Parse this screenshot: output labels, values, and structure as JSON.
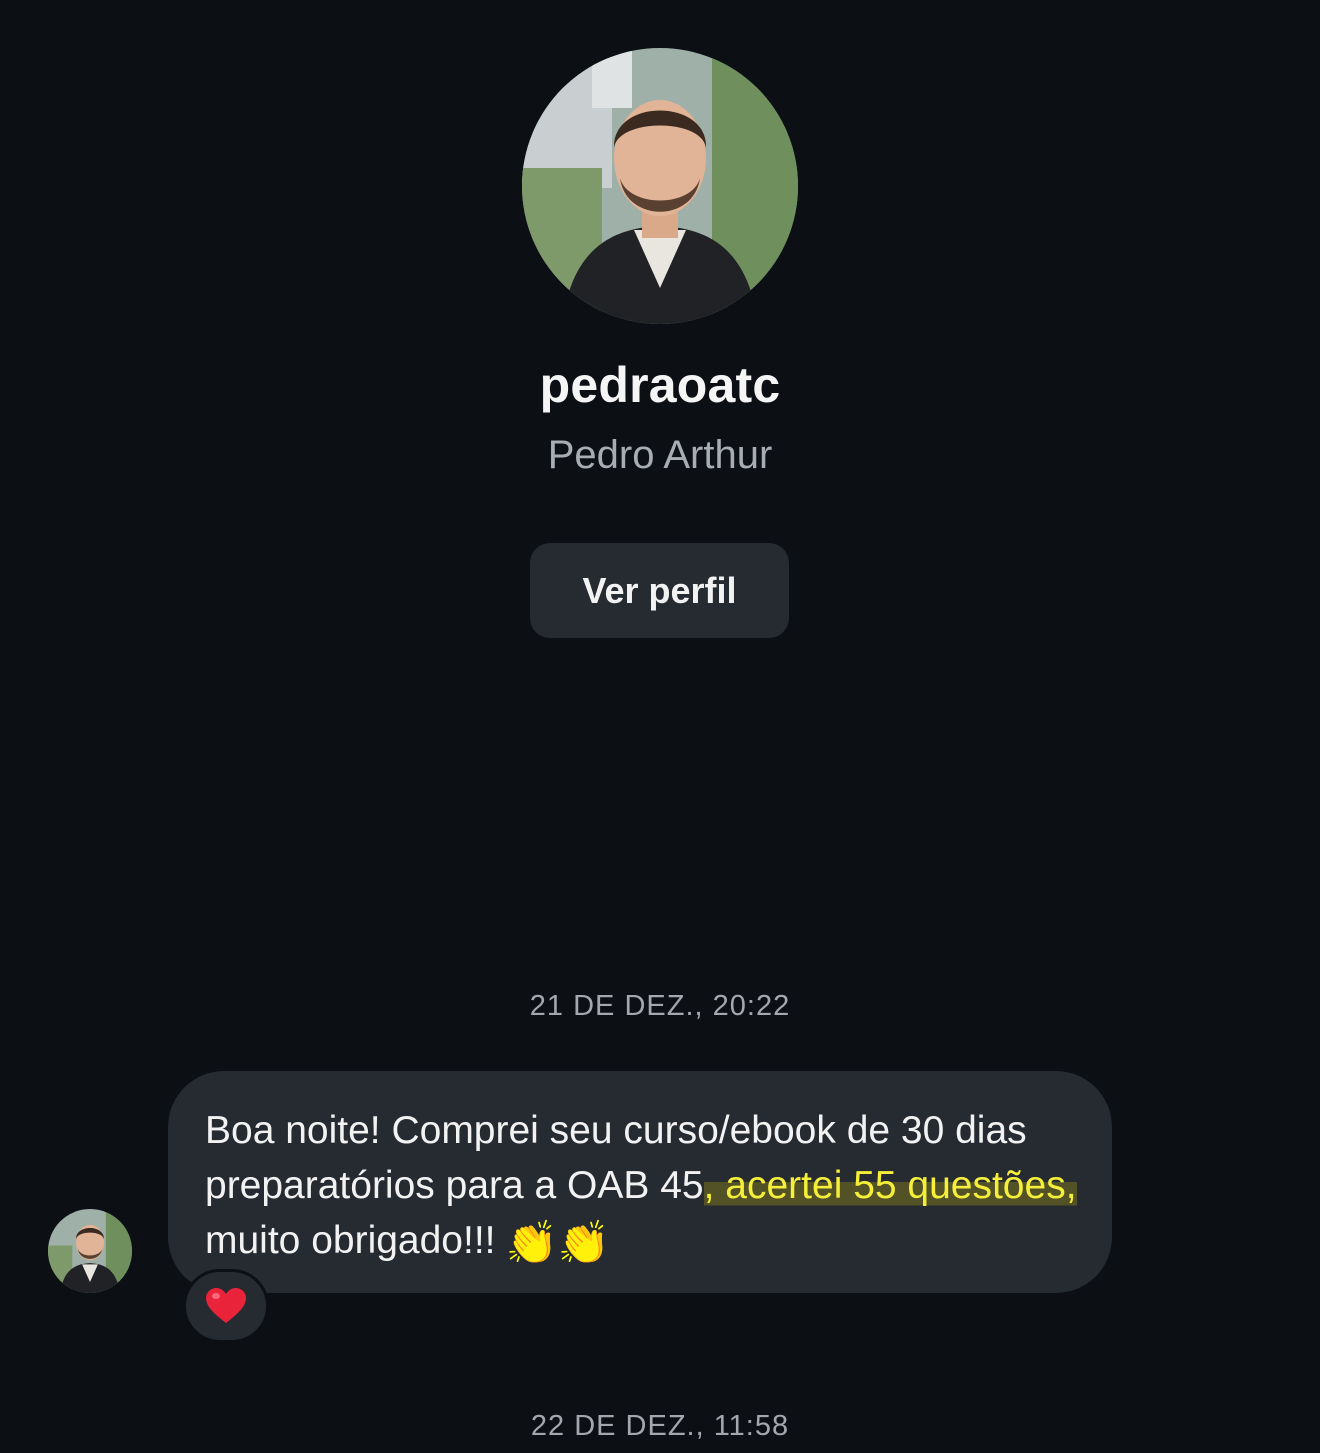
{
  "profile": {
    "username": "pedraoatc",
    "full_name": "Pedro Arthur",
    "view_profile_label": "Ver perfil"
  },
  "conversation": {
    "timestamp_1": "21 DE DEZ., 20:22",
    "message": {
      "part_1": "Boa noite! Comprei seu curso/ebook de 30 dias preparatórios para a OAB 45",
      "part_2_highlighted": ", acertei 55 questões, ",
      "part_3": "muito obrigado!!!",
      "emojis": "👏👏",
      "reaction_icon": "heart-icon",
      "highlight_color": "#f5ef3a"
    },
    "timestamp_2": "22 DE DEZ., 11:58"
  },
  "colors": {
    "background": "#0c0f14",
    "bubble": "#262a31",
    "secondary_text": "#a8acb3",
    "heart": "#e8233a"
  }
}
